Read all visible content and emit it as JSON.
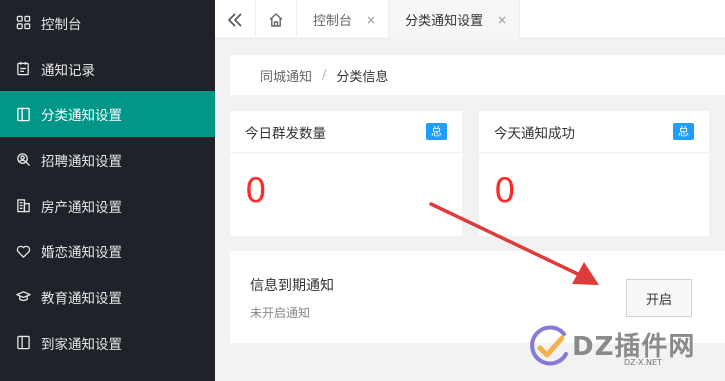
{
  "sidebar": {
    "items": [
      {
        "label": "控制台",
        "icon": "dashboard-icon"
      },
      {
        "label": "通知记录",
        "icon": "record-icon"
      },
      {
        "label": "分类通知设置",
        "icon": "category-icon",
        "active": true
      },
      {
        "label": "招聘通知设置",
        "icon": "recruit-icon"
      },
      {
        "label": "房产通知设置",
        "icon": "building-icon"
      },
      {
        "label": "婚恋通知设置",
        "icon": "heart-icon"
      },
      {
        "label": "教育通知设置",
        "icon": "graduation-cap-icon"
      },
      {
        "label": "到家通知设置",
        "icon": "home-service-icon"
      }
    ]
  },
  "topbar": {
    "tabs": [
      {
        "label": "控制台",
        "close": "×"
      },
      {
        "label": "分类通知设置",
        "close": "×"
      }
    ]
  },
  "breadcrumb": {
    "parent": "同城通知",
    "separator": "/",
    "current": "分类信息"
  },
  "stats": [
    {
      "title": "今日群发数量",
      "badge": "总",
      "value": "0"
    },
    {
      "title": "今天通知成功",
      "badge": "总",
      "value": "0"
    }
  ],
  "notice": {
    "title": "信息到期通知",
    "status": "未开启通知",
    "button": "开启"
  },
  "watermark": {
    "text": "DZ插件网",
    "url": "DZ-X.NET"
  },
  "colors": {
    "sidebar_bg": "#20222a",
    "active": "#009688",
    "value": "#ff2a2a",
    "badge": "#1e9fff",
    "annotation_arrow": "#e03b3b"
  }
}
